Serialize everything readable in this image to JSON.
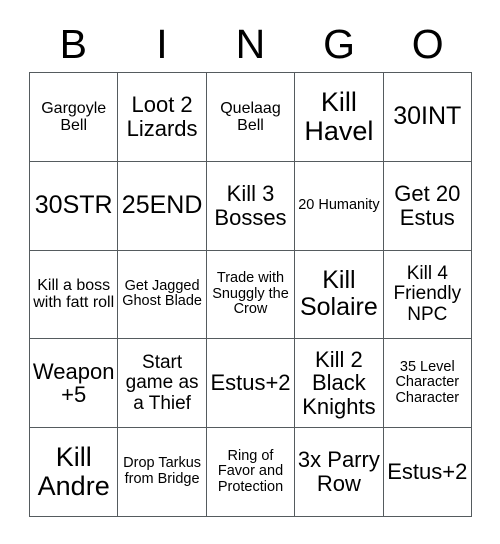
{
  "card": {
    "title": "BINGO",
    "header_letters": [
      "B",
      "I",
      "N",
      "G",
      "O"
    ],
    "rows": [
      [
        {
          "text": "Gargoyle Bell",
          "size": "sm"
        },
        {
          "text": "Loot 2 Lizards",
          "size": "lg"
        },
        {
          "text": "Quelaag Bell",
          "size": "sm"
        },
        {
          "text": "Kill Havel",
          "size": "xxl"
        },
        {
          "text": "30INT",
          "size": "xl"
        }
      ],
      [
        {
          "text": "30STR",
          "size": "xl"
        },
        {
          "text": "25END",
          "size": "xl"
        },
        {
          "text": "Kill 3 Bosses",
          "size": "lg"
        },
        {
          "text": "20 Humanity",
          "size": "xs"
        },
        {
          "text": "Get 20 Estus",
          "size": "lg"
        }
      ],
      [
        {
          "text": "Kill a boss with fatt roll",
          "size": "sm"
        },
        {
          "text": "Get Jagged Ghost Blade",
          "size": "xs"
        },
        {
          "text": "Trade with Snuggly the Crow",
          "size": "xs"
        },
        {
          "text": "Kill Solaire",
          "size": "xl"
        },
        {
          "text": "Kill 4 Friendly NPC",
          "size": "md"
        }
      ],
      [
        {
          "text": "Weapon +5",
          "size": "lg"
        },
        {
          "text": "Start game as a Thief",
          "size": "md"
        },
        {
          "text": "Estus+2",
          "size": "lg"
        },
        {
          "text": "Kill 2 Black Knights",
          "size": "lg"
        },
        {
          "text": "35 Level Character Character",
          "size": "xs"
        }
      ],
      [
        {
          "text": "Kill Andre",
          "size": "xxl"
        },
        {
          "text": "Drop Tarkus from Bridge",
          "size": "xs"
        },
        {
          "text": "Ring of Favor and Protection",
          "size": "xs"
        },
        {
          "text": "3x Parry Row",
          "size": "lg"
        },
        {
          "text": "Estus+2",
          "size": "lg"
        }
      ]
    ]
  },
  "colors": {
    "background": "#ffffff",
    "text": "#000000",
    "grid_line": "#555b5e"
  }
}
